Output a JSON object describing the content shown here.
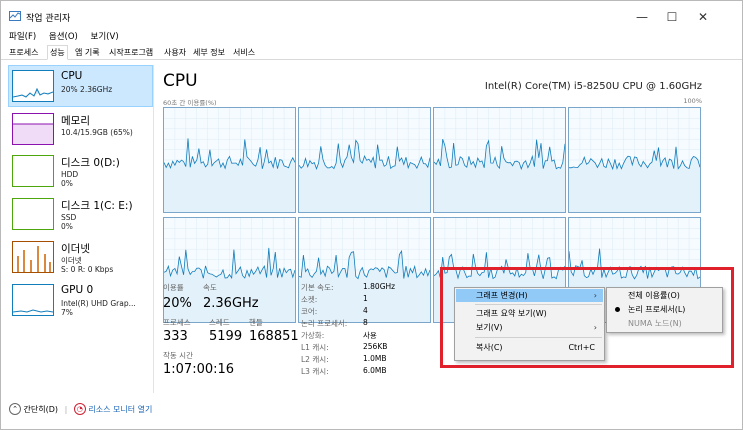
{
  "window": {
    "title": "작업 관리자",
    "min_glyph": "—",
    "max_glyph": "☐",
    "close_glyph": "✕"
  },
  "menu": [
    "파일(F)",
    "옵션(O)",
    "보기(V)"
  ],
  "tabs": [
    "프로세스",
    "성능",
    "앱 기록",
    "시작프로그램",
    "사용자",
    "세부 정보",
    "서비스"
  ],
  "active_tab": "성능",
  "sidebar": {
    "items": [
      {
        "title": "CPU",
        "sub1": "20% 2.36GHz",
        "sub2": "",
        "color": "#117dbb"
      },
      {
        "title": "메모리",
        "sub1": "10.4/15.9GB (65%)",
        "sub2": "",
        "color": "#8b12ae"
      },
      {
        "title": "디스크 0(D:)",
        "sub1": "HDD",
        "sub2": "0%",
        "color": "#4da60c"
      },
      {
        "title": "디스크 1(C: E:)",
        "sub1": "SSD",
        "sub2": "0%",
        "color": "#4da60c"
      },
      {
        "title": "이더넷",
        "sub1": "이더넷",
        "sub2": "S: 0 R: 0 Kbps",
        "color": "#a74f01"
      },
      {
        "title": "GPU 0",
        "sub1": "Intel(R) UHD Grap...",
        "sub2": "7%",
        "color": "#117dbb"
      }
    ]
  },
  "main": {
    "title": "CPU",
    "model": "Intel(R) Core(TM) i5-8250U CPU @ 1.60GHz",
    "graph_caption": "60초 간 이용률(%)",
    "graph_max": "100%",
    "graph_color": "#117dbb",
    "cores": 8
  },
  "stats": {
    "util_label": "이용률",
    "util_value": "20%",
    "speed_label": "속도",
    "speed_value": "2.36GHz",
    "proc_label": "프로세스",
    "proc_value": "333",
    "threads_label": "스레드",
    "threads_value": "5199",
    "handles_label": "핸들",
    "handles_value": "168851",
    "uptime_label": "작동 시간",
    "uptime_value": "1:07:00:16"
  },
  "specs": [
    {
      "k": "기본 속도:",
      "v": "1.80GHz"
    },
    {
      "k": "소켓:",
      "v": "1"
    },
    {
      "k": "코어:",
      "v": "4"
    },
    {
      "k": "논리 프로세서:",
      "v": "8"
    },
    {
      "k": "가상화:",
      "v": "사용"
    },
    {
      "k": "L1 캐시:",
      "v": "256KB"
    },
    {
      "k": "L2 캐시:",
      "v": "1.0MB"
    },
    {
      "k": "L3 캐시:",
      "v": "6.0MB"
    }
  ],
  "context_menu": {
    "items": [
      {
        "label": "그래프 변경(H)",
        "arrow": "›",
        "shortcut": ""
      },
      {
        "label": "그래프 요약 보기(W)",
        "arrow": "",
        "shortcut": ""
      },
      {
        "label": "보기(V)",
        "arrow": "›",
        "shortcut": ""
      },
      {
        "label": "복사(C)",
        "arrow": "",
        "shortcut": "Ctrl+C"
      }
    ],
    "submenu": [
      {
        "label": "전체 이용률(O)",
        "checked": false,
        "disabled": false
      },
      {
        "label": "논리 프로세서(L)",
        "checked": true,
        "disabled": false
      },
      {
        "label": "NUMA 노드(N)",
        "checked": false,
        "disabled": true
      }
    ]
  },
  "footer": {
    "collapse_label": "간단히(D)",
    "monitor_label": "리소스 모니터 열기"
  }
}
